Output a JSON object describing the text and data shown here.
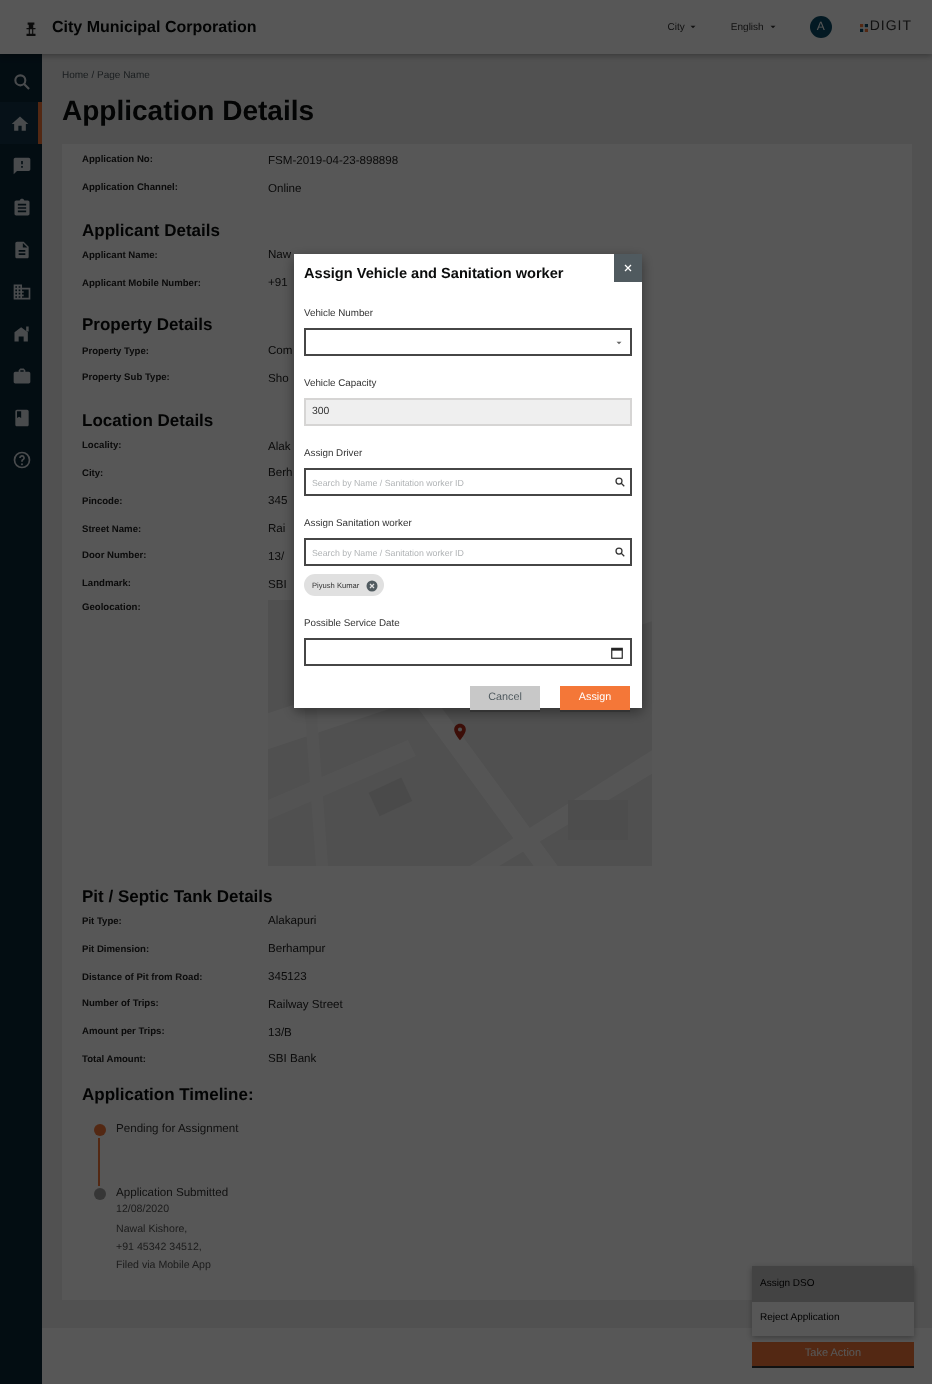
{
  "header": {
    "title": "City Municipal Corporation",
    "city": "City",
    "language": "English",
    "avatar": "A",
    "logo": "DIGIT"
  },
  "sidebar": {
    "items": [
      {
        "selected": false
      },
      {
        "selected": true
      },
      {
        "selected": false
      },
      {
        "selected": false
      },
      {
        "selected": false
      },
      {
        "selected": false
      },
      {
        "selected": false
      },
      {
        "selected": false
      },
      {
        "selected": false
      },
      {
        "selected": false
      }
    ]
  },
  "breadcrumb": "Home / Page Name",
  "page_title": "Application Details",
  "sections": [
    {
      "rows": [
        {
          "kind": "text",
          "label": "Application No:",
          "value": "FSM-2019-04-23-898898"
        },
        {
          "kind": "text",
          "label": "Application Channel:",
          "value": "Online"
        }
      ]
    },
    {
      "heading": "Applicant Details",
      "rows": [
        {
          "kind": "text",
          "label": "Applicant Name:",
          "value": "Naw"
        },
        {
          "kind": "text",
          "label": "Applicant Mobile Number:",
          "value": "+91"
        }
      ]
    },
    {
      "heading": "Property Details",
      "rows": [
        {
          "kind": "text",
          "label": "Property Type:",
          "value": "Com"
        },
        {
          "kind": "text",
          "label": "Property Sub Type:",
          "value": "Sho"
        }
      ]
    },
    {
      "heading": "Location Details",
      "rows": [
        {
          "kind": "text",
          "label": "Locality:",
          "value": "Alak"
        },
        {
          "kind": "text",
          "label": "City:",
          "value": "Berh"
        },
        {
          "kind": "text",
          "label": "Pincode:",
          "value": "345"
        },
        {
          "kind": "text",
          "label": "Street Name:",
          "value": "Rai"
        },
        {
          "kind": "text",
          "label": "Door Number:",
          "value": "13/"
        },
        {
          "kind": "text",
          "label": "Landmark:",
          "value": "SBI"
        },
        {
          "kind": "map",
          "label": "Geolocation:"
        }
      ]
    },
    {
      "heading": "Pit / Septic Tank Details",
      "rows": [
        {
          "kind": "text",
          "label": "Pit Type:",
          "value": "Alakapuri"
        },
        {
          "kind": "text",
          "label": "Pit Dimension:",
          "value": "Berhampur"
        },
        {
          "kind": "text",
          "label": "Distance of Pit from Road:",
          "value": "345123"
        },
        {
          "kind": "text",
          "label": "Number of Trips:",
          "value": "Railway Street"
        },
        {
          "kind": "text",
          "label": "Amount per Trips:",
          "value": "13/B"
        },
        {
          "kind": "text",
          "label": "Total Amount:",
          "value": "SBI Bank"
        }
      ]
    }
  ],
  "timeline": {
    "heading": "Application Timeline:",
    "steps": [
      {
        "title": "Pending for Assignment",
        "color": "#532813"
      },
      {
        "title": "Application Submitted",
        "color": "#363636",
        "details": [
          "12/08/2020",
          "Nawal Kishore,",
          "+91 45342 34512,",
          "Filed via Mobile App"
        ]
      }
    ]
  },
  "actions": {
    "menu": [
      {
        "label": "Assign DSO",
        "selected": true
      },
      {
        "label": "Reject Application",
        "selected": false
      }
    ],
    "button": "Take Action"
  },
  "dialog": {
    "title": "Assign Vehicle and Sanitation worker",
    "fields": [
      {
        "kind": "select",
        "label": "Vehicle Number"
      },
      {
        "kind": "readonly",
        "label": "Vehicle Capacity",
        "value": "300"
      },
      {
        "kind": "search",
        "label": "Assign Driver",
        "placeholder": "Search by Name / Sanitation worker ID"
      },
      {
        "kind": "search",
        "label": "Assign Sanitation worker",
        "placeholder": "Search by Name / Sanitation worker ID",
        "chips": [
          "Piyush Kumar"
        ]
      },
      {
        "kind": "date",
        "label": "Possible Service Date"
      }
    ],
    "buttons": [
      {
        "kind": "secondary",
        "label": "Cancel"
      },
      {
        "kind": "primary",
        "label": "Assign"
      }
    ]
  }
}
